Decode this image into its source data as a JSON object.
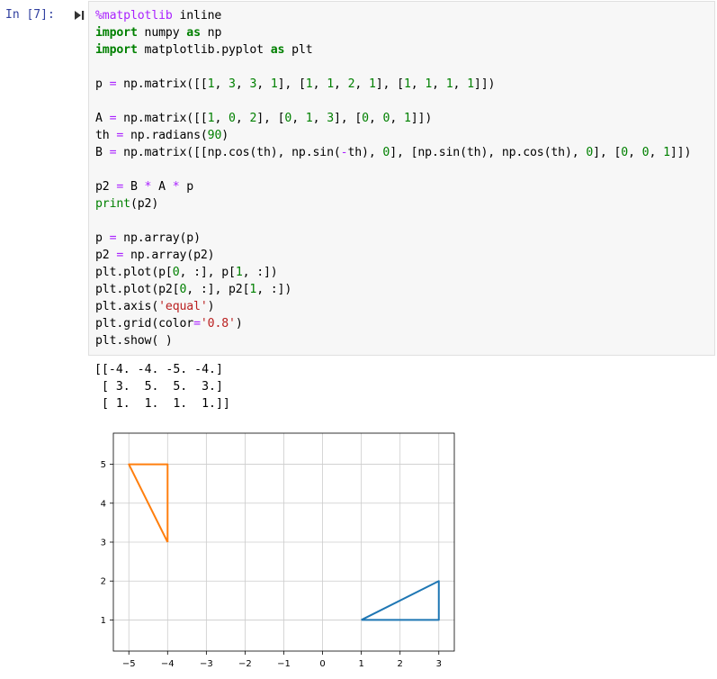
{
  "cell": {
    "prompt": "In [7]:",
    "code_lines": [
      [
        {
          "t": "%matplotlib",
          "c": "mag"
        },
        {
          "t": " inline",
          "c": ""
        }
      ],
      [
        {
          "t": "import",
          "c": "kw"
        },
        {
          "t": " numpy ",
          "c": ""
        },
        {
          "t": "as",
          "c": "kw"
        },
        {
          "t": " np",
          "c": ""
        }
      ],
      [
        {
          "t": "import",
          "c": "kw"
        },
        {
          "t": " matplotlib.pyplot ",
          "c": ""
        },
        {
          "t": "as",
          "c": "kw"
        },
        {
          "t": " plt",
          "c": ""
        }
      ],
      [],
      [
        {
          "t": "p ",
          "c": ""
        },
        {
          "t": "=",
          "c": "op"
        },
        {
          "t": " np.matrix([[",
          "c": ""
        },
        {
          "t": "1",
          "c": "num"
        },
        {
          "t": ", ",
          "c": ""
        },
        {
          "t": "3",
          "c": "num"
        },
        {
          "t": ", ",
          "c": ""
        },
        {
          "t": "3",
          "c": "num"
        },
        {
          "t": ", ",
          "c": ""
        },
        {
          "t": "1",
          "c": "num"
        },
        {
          "t": "], [",
          "c": ""
        },
        {
          "t": "1",
          "c": "num"
        },
        {
          "t": ", ",
          "c": ""
        },
        {
          "t": "1",
          "c": "num"
        },
        {
          "t": ", ",
          "c": ""
        },
        {
          "t": "2",
          "c": "num"
        },
        {
          "t": ", ",
          "c": ""
        },
        {
          "t": "1",
          "c": "num"
        },
        {
          "t": "], [",
          "c": ""
        },
        {
          "t": "1",
          "c": "num"
        },
        {
          "t": ", ",
          "c": ""
        },
        {
          "t": "1",
          "c": "num"
        },
        {
          "t": ", ",
          "c": ""
        },
        {
          "t": "1",
          "c": "num"
        },
        {
          "t": ", ",
          "c": ""
        },
        {
          "t": "1",
          "c": "num"
        },
        {
          "t": "]])",
          "c": ""
        }
      ],
      [],
      [
        {
          "t": "A ",
          "c": ""
        },
        {
          "t": "=",
          "c": "op"
        },
        {
          "t": " np.matrix([[",
          "c": ""
        },
        {
          "t": "1",
          "c": "num"
        },
        {
          "t": ", ",
          "c": ""
        },
        {
          "t": "0",
          "c": "num"
        },
        {
          "t": ", ",
          "c": ""
        },
        {
          "t": "2",
          "c": "num"
        },
        {
          "t": "], [",
          "c": ""
        },
        {
          "t": "0",
          "c": "num"
        },
        {
          "t": ", ",
          "c": ""
        },
        {
          "t": "1",
          "c": "num"
        },
        {
          "t": ", ",
          "c": ""
        },
        {
          "t": "3",
          "c": "num"
        },
        {
          "t": "], [",
          "c": ""
        },
        {
          "t": "0",
          "c": "num"
        },
        {
          "t": ", ",
          "c": ""
        },
        {
          "t": "0",
          "c": "num"
        },
        {
          "t": ", ",
          "c": ""
        },
        {
          "t": "1",
          "c": "num"
        },
        {
          "t": "]])",
          "c": ""
        }
      ],
      [
        {
          "t": "th ",
          "c": ""
        },
        {
          "t": "=",
          "c": "op"
        },
        {
          "t": " np.radians(",
          "c": ""
        },
        {
          "t": "90",
          "c": "num"
        },
        {
          "t": ")",
          "c": ""
        }
      ],
      [
        {
          "t": "B ",
          "c": ""
        },
        {
          "t": "=",
          "c": "op"
        },
        {
          "t": " np.matrix([[np.cos(th), np.sin(",
          "c": ""
        },
        {
          "t": "-",
          "c": "op"
        },
        {
          "t": "th), ",
          "c": ""
        },
        {
          "t": "0",
          "c": "num"
        },
        {
          "t": "], [np.sin(th), np.cos(th), ",
          "c": ""
        },
        {
          "t": "0",
          "c": "num"
        },
        {
          "t": "], [",
          "c": ""
        },
        {
          "t": "0",
          "c": "num"
        },
        {
          "t": ", ",
          "c": ""
        },
        {
          "t": "0",
          "c": "num"
        },
        {
          "t": ", ",
          "c": ""
        },
        {
          "t": "1",
          "c": "num"
        },
        {
          "t": "]])",
          "c": ""
        }
      ],
      [],
      [
        {
          "t": "p2 ",
          "c": ""
        },
        {
          "t": "=",
          "c": "op"
        },
        {
          "t": " B ",
          "c": ""
        },
        {
          "t": "*",
          "c": "op"
        },
        {
          "t": " A ",
          "c": ""
        },
        {
          "t": "*",
          "c": "op"
        },
        {
          "t": " p",
          "c": ""
        }
      ],
      [
        {
          "t": "print",
          "c": "bi"
        },
        {
          "t": "(p2)",
          "c": ""
        }
      ],
      [],
      [
        {
          "t": "p ",
          "c": ""
        },
        {
          "t": "=",
          "c": "op"
        },
        {
          "t": " np.array(p)",
          "c": ""
        }
      ],
      [
        {
          "t": "p2 ",
          "c": ""
        },
        {
          "t": "=",
          "c": "op"
        },
        {
          "t": " np.array(p2)",
          "c": ""
        }
      ],
      [
        {
          "t": "plt.plot(p[",
          "c": ""
        },
        {
          "t": "0",
          "c": "num"
        },
        {
          "t": ", :], p[",
          "c": ""
        },
        {
          "t": "1",
          "c": "num"
        },
        {
          "t": ", :])",
          "c": ""
        }
      ],
      [
        {
          "t": "plt.plot(p2[",
          "c": ""
        },
        {
          "t": "0",
          "c": "num"
        },
        {
          "t": ", :], p2[",
          "c": ""
        },
        {
          "t": "1",
          "c": "num"
        },
        {
          "t": ", :])",
          "c": ""
        }
      ],
      [
        {
          "t": "plt.axis(",
          "c": ""
        },
        {
          "t": "'equal'",
          "c": "str"
        },
        {
          "t": ")",
          "c": ""
        }
      ],
      [
        {
          "t": "plt.grid(color",
          "c": ""
        },
        {
          "t": "=",
          "c": "op"
        },
        {
          "t": "'0.8'",
          "c": "str"
        },
        {
          "t": ")",
          "c": ""
        }
      ],
      [
        {
          "t": "plt.show( )",
          "c": ""
        }
      ]
    ],
    "output_text": "[[-4. -4. -5. -4.]\n [ 3.  5.  5.  3.]\n [ 1.  1.  1.  1.]]"
  },
  "colors": {
    "prompt": "#303f9f",
    "series_1": "#1f77b4",
    "series_2": "#ff7f0e",
    "grid": "#cccccc"
  },
  "chart_data": {
    "type": "line",
    "xlim": [
      -5.4,
      3.4
    ],
    "ylim": [
      0.2,
      5.8
    ],
    "xticks": [
      -5,
      -4,
      -3,
      -2,
      -1,
      0,
      1,
      2,
      3
    ],
    "yticks": [
      1,
      2,
      3,
      4,
      5
    ],
    "xtick_labels": [
      "−5",
      "−4",
      "−3",
      "−2",
      "−1",
      "0",
      "1",
      "2",
      "3"
    ],
    "ytick_labels": [
      "1",
      "2",
      "3",
      "4",
      "5"
    ],
    "grid": true,
    "series": [
      {
        "x": [
          1,
          3,
          3,
          1
        ],
        "y": [
          1,
          1,
          2,
          1
        ],
        "color": "#1f77b4"
      },
      {
        "x": [
          -4,
          -4,
          -5,
          -4
        ],
        "y": [
          3,
          5,
          5,
          3
        ],
        "color": "#ff7f0e"
      }
    ]
  }
}
